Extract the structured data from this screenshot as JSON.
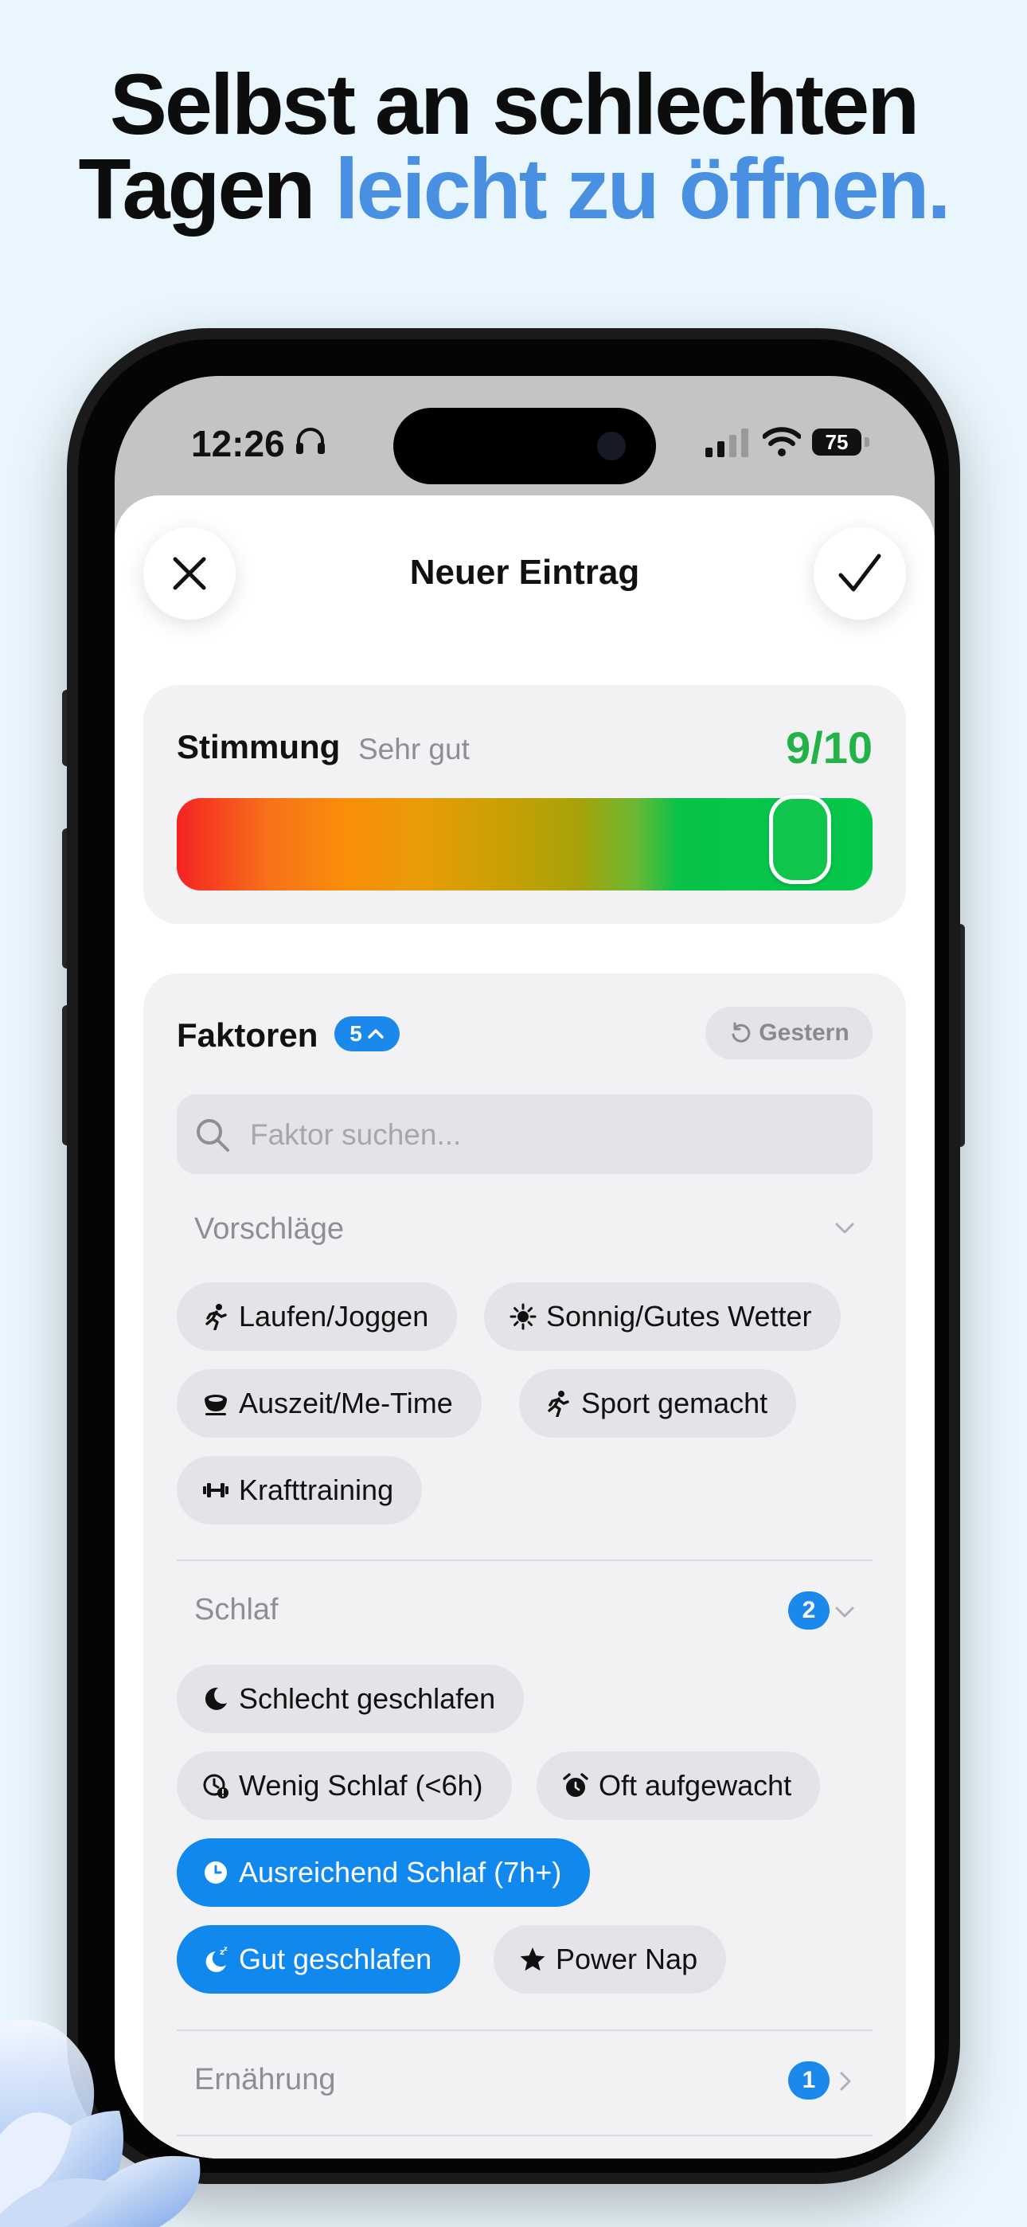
{
  "headline": {
    "line1": "Selbst an schlechten",
    "line2_plain": "Tagen",
    "line2_accent": "leicht zu öffnen."
  },
  "status_bar": {
    "time": "12:26",
    "battery": "75"
  },
  "sheet": {
    "title": "Neuer Eintrag"
  },
  "mood": {
    "label": "Stimmung",
    "description": "Sehr gut",
    "score_text": "9/10",
    "score_fraction": 0.9
  },
  "factors": {
    "title": "Faktoren",
    "count_badge": "5",
    "yesterday_label": "Gestern",
    "search_placeholder": "Faktor suchen...",
    "suggestions": {
      "label": "Vorschläge",
      "chips": [
        "Laufen/Joggen",
        "Sonnig/Gutes Wetter",
        "Auszeit/Me-Time",
        "Sport gemacht",
        "Krafttraining"
      ]
    },
    "sleep": {
      "label": "Schlaf",
      "badge": "2",
      "chips": [
        "Schlecht geschlafen",
        "Wenig Schlaf (<6h)",
        "Oft aufgewacht",
        "Ausreichend Schlaf (7h+)",
        "Gut geschlafen",
        "Power Nap"
      ],
      "selected": [
        "Ausreichend Schlaf (7h+)",
        "Gut geschlafen"
      ]
    },
    "nutrition": {
      "label": "Ernährung",
      "badge": "1"
    }
  },
  "colors": {
    "accent": "#4a90e2",
    "selected_chip": "#1088ed",
    "score_green": "#22b248"
  }
}
